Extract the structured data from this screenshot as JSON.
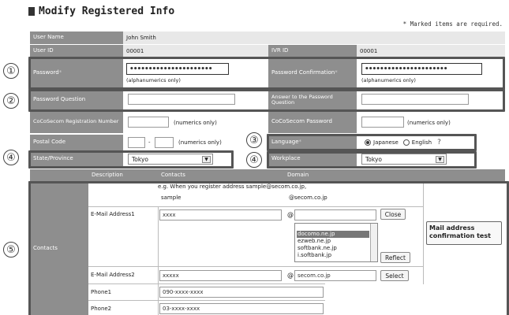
{
  "title": "Modify Registered Info",
  "required_note": "* Marked items are required.",
  "user": {
    "name_label": "User Name",
    "name_value": "John Smith",
    "id_label": "User ID",
    "id_value": "00001",
    "ivr_label": "IVR ID",
    "ivr_value": "00001"
  },
  "password": {
    "label": "Password",
    "value": "••••••••••••••••••••••",
    "hint": "(alphanumerics only)",
    "confirm_label": "Password Confirmation",
    "confirm_value": "••••••••••••••••••••••",
    "confirm_hint": "(alphanumerics only)"
  },
  "question": {
    "label": "Password Question",
    "answer_label": "Answer to the Password Question"
  },
  "cocosecom": {
    "reg_label": "CoCoSecom Registration Number",
    "reg_hint": "(numerics only)",
    "pw_label": "CoCoSecom Password",
    "pw_hint": "(numerics only)"
  },
  "postal": {
    "label": "Postal Code",
    "dash": "-",
    "hint": "(numerics only)"
  },
  "language": {
    "label": "Language",
    "opt_ja": "Japanese",
    "opt_en": "English",
    "help_icon": "help-icon"
  },
  "state": {
    "label": "State/Province",
    "value": "Tokyo"
  },
  "workplace": {
    "label": "Workplace",
    "value": "Tokyo"
  },
  "contacts_table": {
    "headers": [
      "Description",
      "Contacts",
      "Domain"
    ],
    "row_label": "Contacts",
    "example_line1": "e.g. When you register address sample@secom.co.jp,",
    "example_contact": "sample",
    "example_domain": "@secom.co.jp",
    "email1_label": "E-Mail Address1",
    "email1_value": "xxxx",
    "email2_label": "E-Mail Address2",
    "email2_value": "xxxxx",
    "at": "@",
    "domain2_value": "secom.co.jp",
    "close_btn": "Close",
    "reflect_btn": "Reflect",
    "select_btn": "Select",
    "domain_options": [
      "docomo.ne.jp",
      "ezweb.ne.jp",
      "softbank.ne.jp",
      "i.softbank.jp"
    ],
    "test_btn": "Mail address confirmation test",
    "phone1_label": "Phone1",
    "phone1_value": "090-xxxx-xxxx",
    "phone2_label": "Phone2",
    "phone2_value": "03-xxxx-xxxx"
  },
  "callouts": [
    "①",
    "②",
    "③",
    "④",
    "④",
    "⑤"
  ]
}
